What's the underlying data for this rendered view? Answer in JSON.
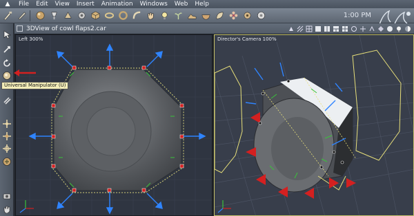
{
  "menubar": {
    "items": [
      "File",
      "Edit",
      "View",
      "Insert",
      "Animation",
      "Windows",
      "Web",
      "Help"
    ]
  },
  "toolbar": {
    "clock": "1:00 PM",
    "icons": [
      "brush-icon",
      "sphere-icon",
      "spotlight-icon",
      "shape-icon",
      "gear-icon",
      "cube-icon",
      "ring-icon",
      "torus-icon",
      "bend-icon",
      "hand-icon",
      "light-icon",
      "sprout-icon",
      "shoe-icon",
      "bowl-icon",
      "leaf-icon",
      "flower-icon",
      "gear-small-icon",
      "disc-icon"
    ]
  },
  "palette": {
    "tooltip": "Universal Manipulator (U)",
    "icons": [
      "arrow-select-icon",
      "move-icon",
      "rotate-icon",
      "universal-manipulator-icon",
      "link-icon",
      "translate-icon",
      "scale-icon",
      "group-icon",
      "magnet-icon",
      "camera-icon",
      "hand-pan-icon"
    ]
  },
  "window": {
    "title": "3DView of cowl flaps2.car",
    "view_icons": [
      "render-full-icon",
      "wireframe-icon",
      "grid-icon",
      "layout-1-icon",
      "layout-2-icon",
      "layout-3-icon",
      "layout-4-icon",
      "camera-front-icon",
      "camera-side-icon",
      "camera-top-icon",
      "shade-icon",
      "sphere-shade-icon",
      "light-bulb-icon",
      "half-moon-icon"
    ]
  },
  "viewports": {
    "left": {
      "label": "Left 300%"
    },
    "right": {
      "label": "Director's Camera 100%"
    }
  },
  "colors": {
    "accent_red": "#d42020",
    "bbox_yellow": "#e8e07a",
    "axis_blue": "#2f84ff",
    "axis_green": "#39c43a"
  }
}
